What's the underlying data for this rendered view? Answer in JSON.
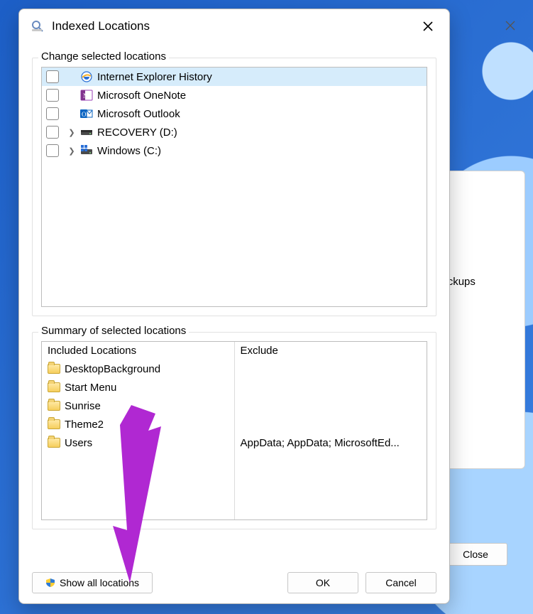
{
  "dialog": {
    "title": "Indexed Locations",
    "group1_label": "Change selected locations",
    "group2_label": "Summary of selected locations",
    "tree": [
      {
        "icon": "ie",
        "label": "Internet Explorer History",
        "expandable": false,
        "selected": true
      },
      {
        "icon": "onenote",
        "label": "Microsoft OneNote",
        "expandable": false,
        "selected": false
      },
      {
        "icon": "outlook",
        "label": "Microsoft Outlook",
        "expandable": false,
        "selected": false
      },
      {
        "icon": "drive",
        "label": "RECOVERY (D:)",
        "expandable": true,
        "selected": false
      },
      {
        "icon": "windrv",
        "label": "Windows (C:)",
        "expandable": true,
        "selected": false
      }
    ],
    "summary": {
      "included_header": "Included Locations",
      "exclude_header": "Exclude",
      "included": [
        {
          "name": "DesktopBackground",
          "exclude": ""
        },
        {
          "name": "Start Menu",
          "exclude": ""
        },
        {
          "name": "Sunrise",
          "exclude": ""
        },
        {
          "name": "Theme2",
          "exclude": ""
        },
        {
          "name": "Users",
          "exclude": "AppData; AppData; MicrosoftEd..."
        }
      ]
    },
    "buttons": {
      "show_all": "Show all locations",
      "ok": "OK",
      "cancel": "Cancel"
    }
  },
  "parent": {
    "close_label": "Close",
    "peek_text": "eBackups"
  }
}
